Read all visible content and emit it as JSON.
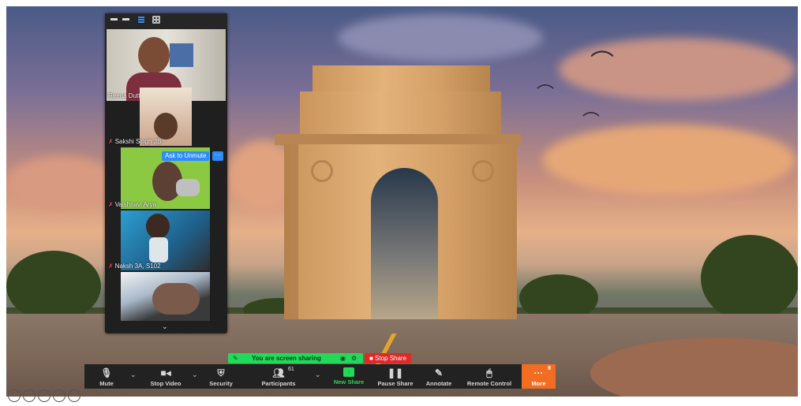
{
  "panel": {
    "participants": [
      {
        "name": "Reena Dutta",
        "muted": false
      },
      {
        "name": "Sakshi Singh 3B",
        "muted": true
      },
      {
        "name": "Vaishnavi Arya",
        "muted": true
      },
      {
        "name": "Naksh 3A, S102",
        "muted": true
      },
      {
        "name": "",
        "muted": false
      }
    ],
    "ask_to_unmute_label": "Ask to Unmute",
    "more_label": "···"
  },
  "share_bar": {
    "status": "You are screen sharing",
    "stop_label": "Stop Share"
  },
  "toolbar": {
    "mute": "Mute",
    "stop_video": "Stop Video",
    "security": "Security",
    "participants": "Participants",
    "participants_count": "61",
    "new_share": "New Share",
    "pause_share": "Pause Share",
    "annotate": "Annotate",
    "remote_control": "Remote Control",
    "more": "More",
    "more_badge": "8"
  },
  "colors": {
    "share_green": "#23d959",
    "stop_red": "#e02828",
    "more_orange": "#f26d21",
    "unmute_blue": "#2d8cff"
  }
}
